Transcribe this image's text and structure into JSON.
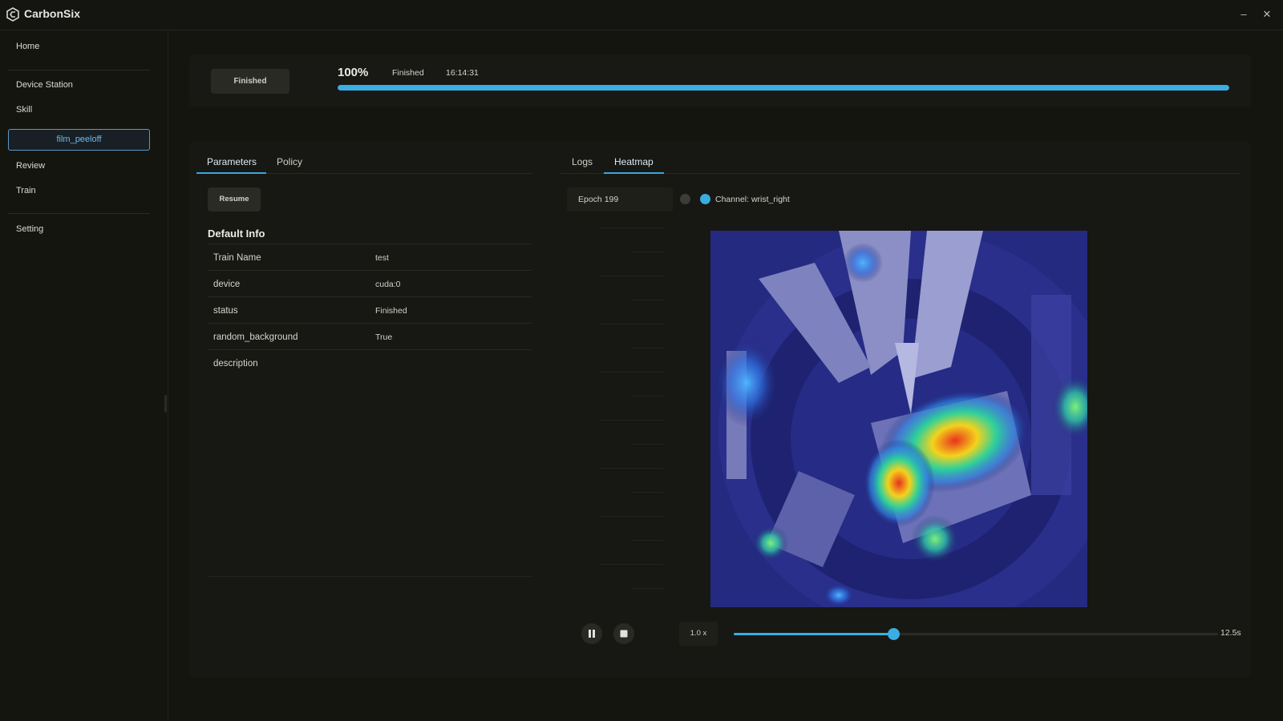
{
  "app": {
    "title": "CarbonSix",
    "logo_icon": "carbonsix-logo-icon"
  },
  "window": {
    "minimize_glyph": "–",
    "close_glyph": "✕"
  },
  "sidebar": {
    "items": [
      {
        "label": "Home"
      },
      {
        "label": "Device Station"
      },
      {
        "label": "Skill"
      },
      {
        "label": "film_peeloff",
        "active": true
      },
      {
        "label": "Review"
      },
      {
        "label": "Train"
      },
      {
        "label": "Setting"
      }
    ]
  },
  "status": {
    "button_label": "Finished",
    "percent_label": "100%",
    "progress_fraction": 1.0,
    "state": "Finished",
    "time": "16:14:31"
  },
  "left_tabs": [
    {
      "label": "Parameters",
      "active": true
    },
    {
      "label": "Policy",
      "active": false
    }
  ],
  "right_tabs": [
    {
      "label": "Logs",
      "active": false
    },
    {
      "label": "Heatmap",
      "active": true
    }
  ],
  "parameters": {
    "resume_label": "Resume",
    "section_title": "Default Info",
    "rows": [
      {
        "key": "Train Name",
        "value": "test"
      },
      {
        "key": "device",
        "value": "cuda:0"
      },
      {
        "key": "status",
        "value": "Finished"
      },
      {
        "key": "random_background",
        "value": "True"
      },
      {
        "key": "description",
        "value": ""
      }
    ]
  },
  "heatmap": {
    "epoch_label": "Epoch 199",
    "channel_label": "Channel: wrist_right",
    "speed_label": "1.0 x",
    "duration_label": "12.5s",
    "playback_fraction": 0.33,
    "colors": {
      "accent": "#39aee2",
      "hot": "#e8321e",
      "warm": "#f4d21c",
      "cool": "#2fd19a",
      "base": "#1c1f6a"
    }
  }
}
